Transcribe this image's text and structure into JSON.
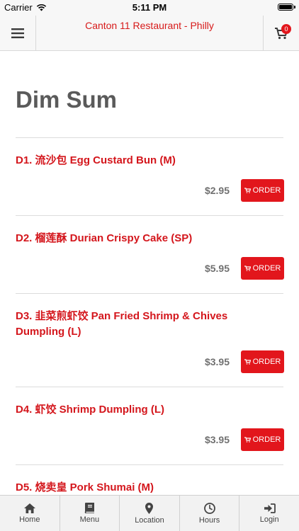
{
  "status_bar": {
    "carrier": "Carrier",
    "time": "5:11 PM"
  },
  "header": {
    "title": "Canton 11 Restaurant - Philly",
    "cart_count": "0"
  },
  "section": {
    "title": "Dim Sum"
  },
  "items": [
    {
      "name": "D1. 流沙包 Egg Custard Bun (M)",
      "price": "$2.95",
      "order_label": "ORDER"
    },
    {
      "name": "D2. 榴莲酥 Durian Crispy Cake (SP)",
      "price": "$5.95",
      "order_label": "ORDER"
    },
    {
      "name": "D3. 韭菜煎虾饺 Pan Fried Shrimp & Chives Dumpling (L)",
      "price": "$3.95",
      "order_label": "ORDER"
    },
    {
      "name": "D4. 虾饺 Shrimp Dumpling (L)",
      "price": "$3.95",
      "order_label": "ORDER"
    },
    {
      "name": "D5. 烧卖皇 Pork Shumai (M)"
    }
  ],
  "tabbar": [
    {
      "label": "Home",
      "icon": "home-icon"
    },
    {
      "label": "Menu",
      "icon": "book-icon"
    },
    {
      "label": "Location",
      "icon": "location-pin-icon"
    },
    {
      "label": "Hours",
      "icon": "clock-icon"
    },
    {
      "label": "Login",
      "icon": "login-icon"
    }
  ],
  "colors": {
    "accent": "#e2161c",
    "title_red": "#d71a1a",
    "section_gray": "#5a5a5a"
  }
}
